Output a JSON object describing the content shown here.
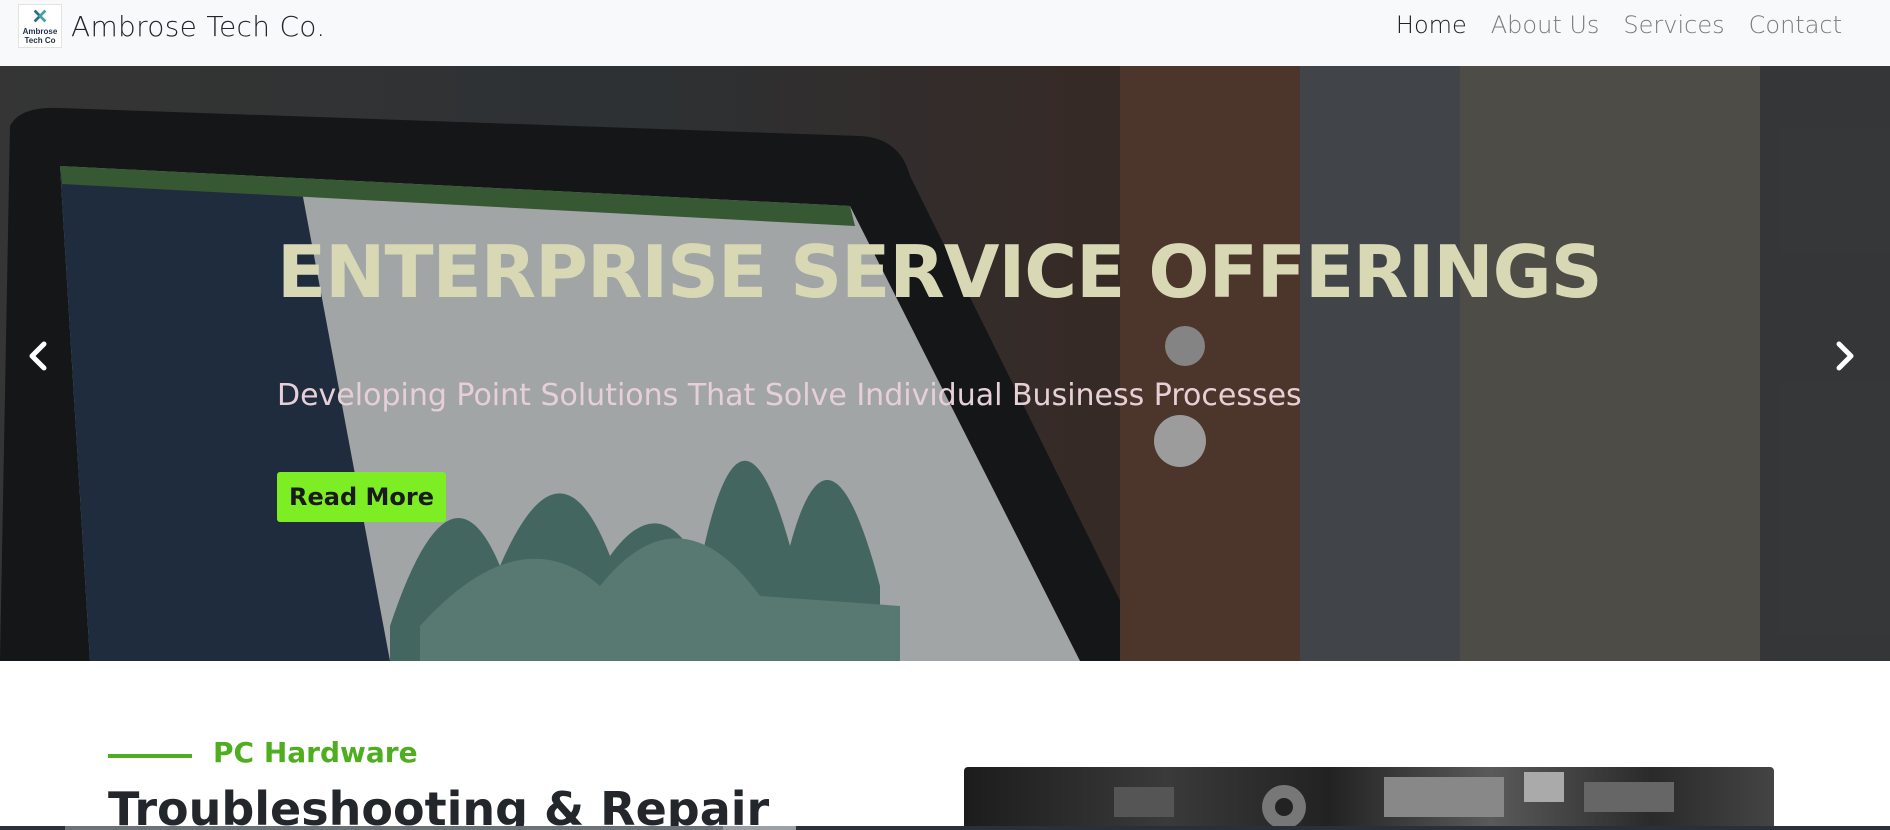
{
  "brand": {
    "logo_line1": "Ambrose",
    "logo_line2": "Tech Co",
    "name": "Ambrose Tech Co."
  },
  "nav": {
    "items": [
      {
        "label": "Home",
        "active": true
      },
      {
        "label": "About Us",
        "active": false
      },
      {
        "label": "Services",
        "active": false
      },
      {
        "label": "Contact",
        "active": false
      }
    ]
  },
  "hero": {
    "title": "ENTERPRISE SERVICE OFFERINGS",
    "subtitle": "Developing Point Solutions That Solve Individual Business Processes",
    "button_label": "Read More",
    "prev_icon": "chevron-left-icon",
    "next_icon": "chevron-right-icon"
  },
  "section": {
    "label": "PC Hardware",
    "heading": "Troubleshooting & Repair"
  },
  "colors": {
    "accent_green": "#7ded24",
    "label_green": "#4fae1f",
    "title_color": "#d8d8b5",
    "subtitle_color": "#e6cfd6",
    "navbar_bg": "#f8f9fa"
  }
}
